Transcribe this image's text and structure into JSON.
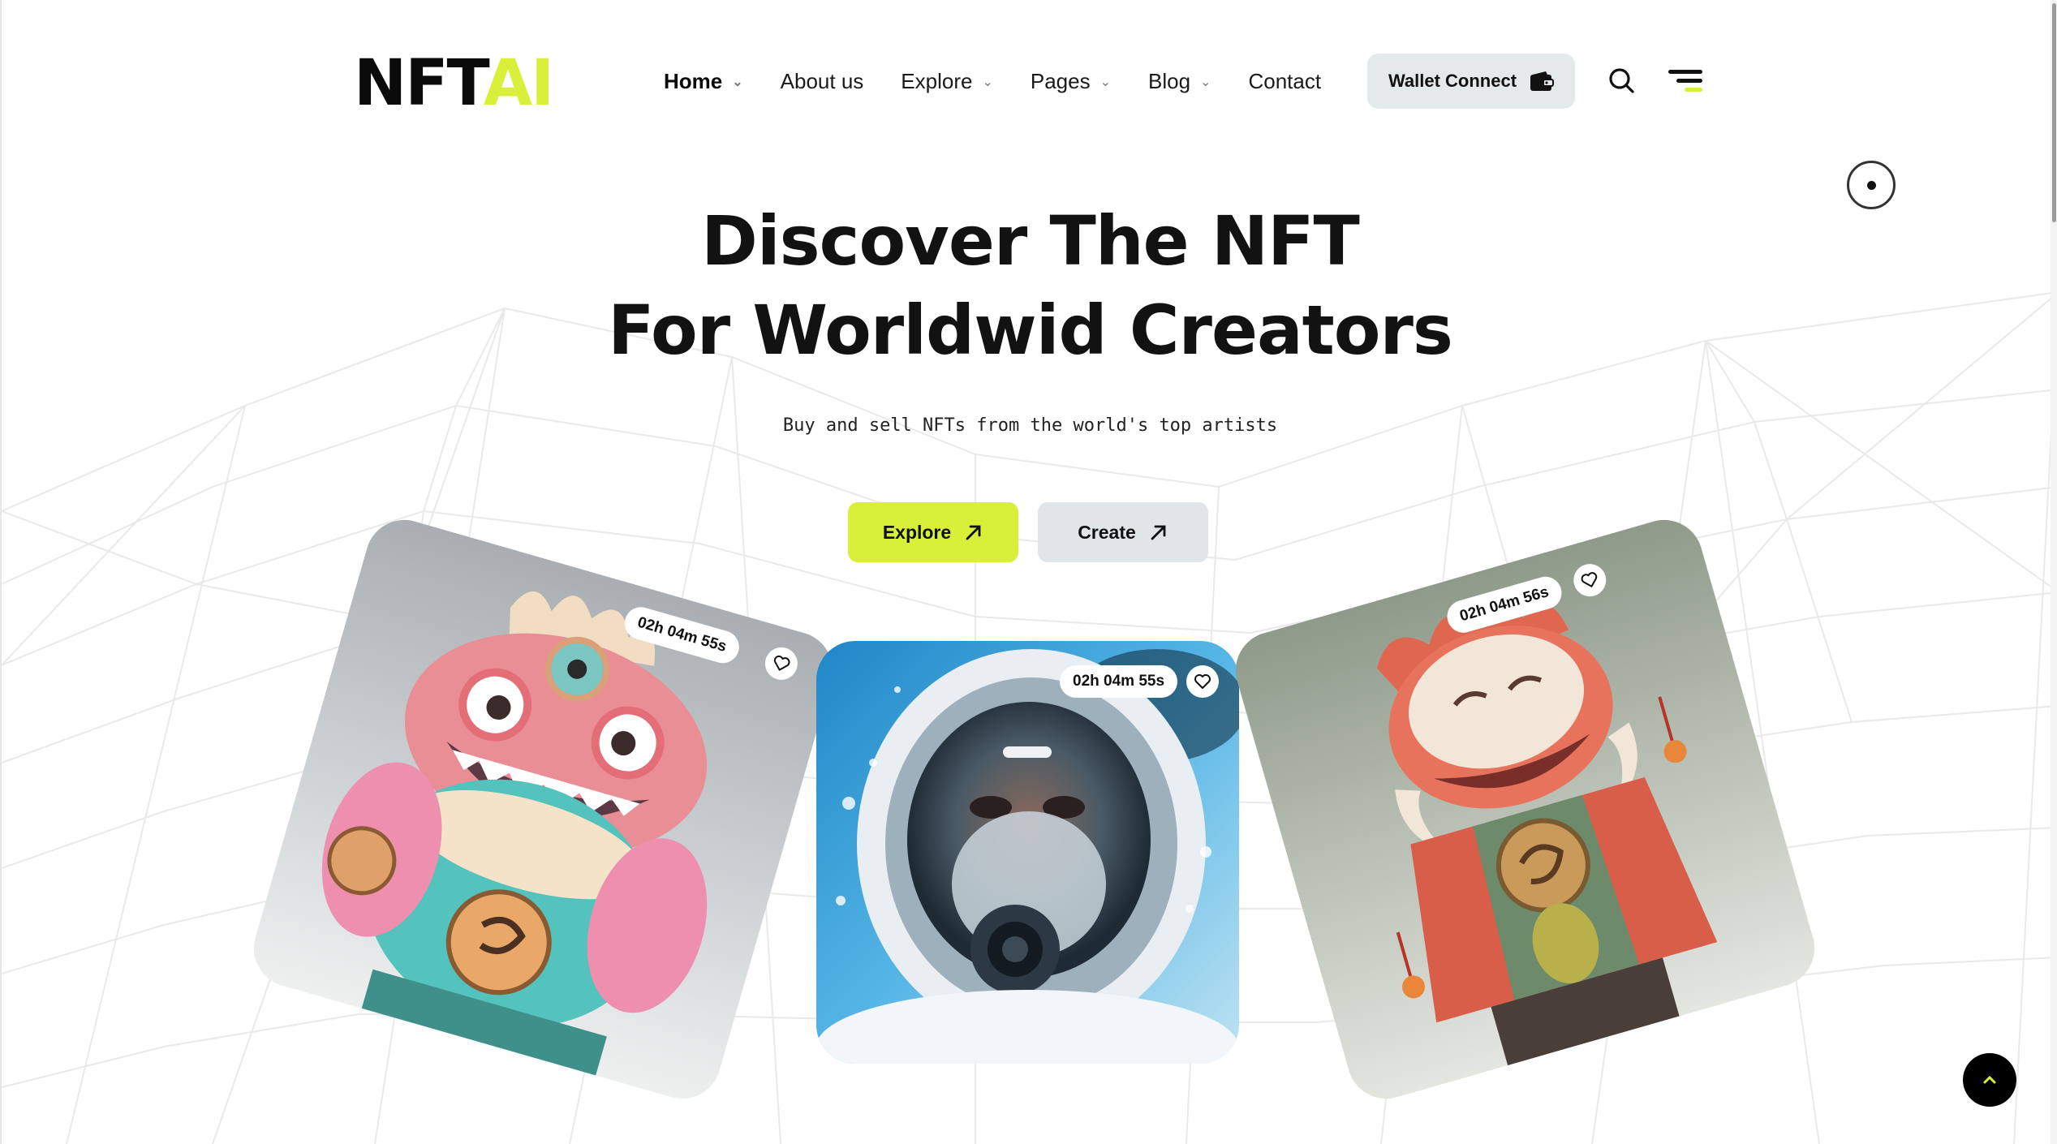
{
  "brand": {
    "logo_part1": "NFT",
    "logo_part2": "AI",
    "accent": "#d8f03a"
  },
  "nav": {
    "items": [
      {
        "label": "Home",
        "dropdown": true,
        "active": true
      },
      {
        "label": "About us",
        "dropdown": false,
        "active": false
      },
      {
        "label": "Explore",
        "dropdown": true,
        "active": false
      },
      {
        "label": "Pages",
        "dropdown": true,
        "active": false
      },
      {
        "label": "Blog",
        "dropdown": true,
        "active": false
      },
      {
        "label": "Contact",
        "dropdown": false,
        "active": false
      }
    ],
    "wallet_label": "Wallet Connect",
    "icons": {
      "wallet": "wallet-icon",
      "search": "search-icon",
      "menu": "menu-icon"
    }
  },
  "hero": {
    "title_line1": "Discover The NFT",
    "title_line2": "For Worldwid Creators",
    "subtitle": "Buy and sell NFTs from the world's top artists",
    "explore_label": "Explore",
    "create_label": "Create"
  },
  "cards": [
    {
      "name": "pink-monster-art",
      "timer": "02h 04m 55s"
    },
    {
      "name": "diver-helmet-art",
      "timer": "02h 04m 55s"
    },
    {
      "name": "red-dragon-art",
      "timer": "02h 04m 56s"
    }
  ]
}
